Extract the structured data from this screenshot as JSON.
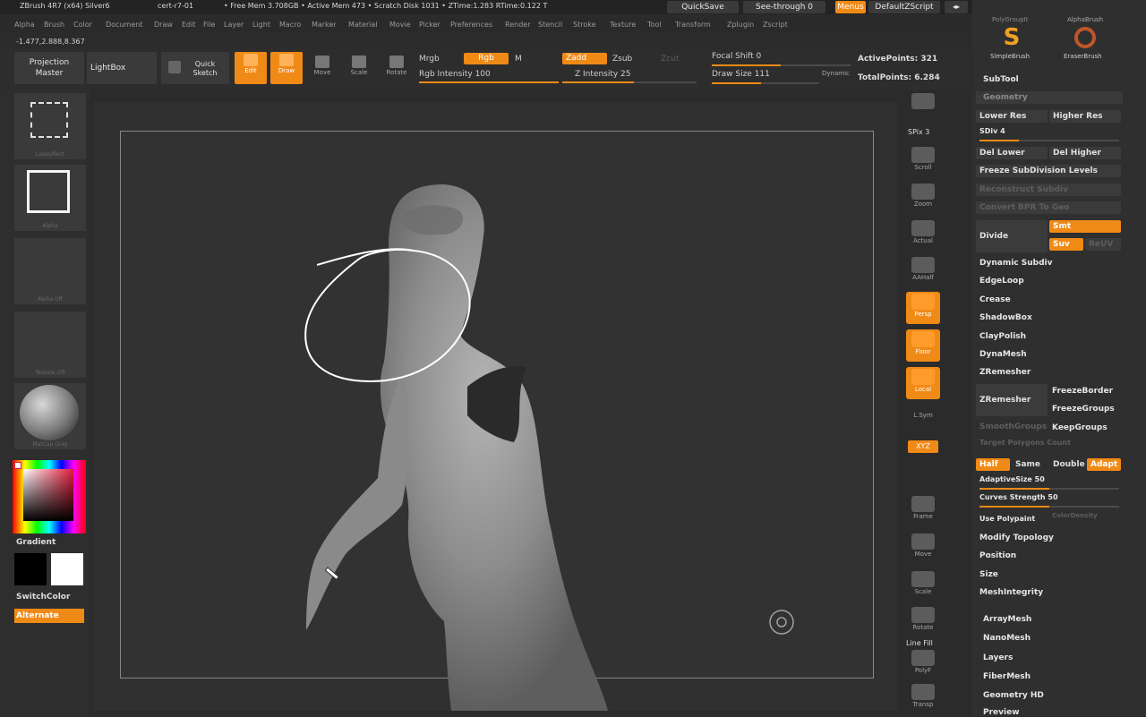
{
  "window": {
    "title": "ZBrush 4R7 (x64) Silver6",
    "doc": "cert-r7-01",
    "stats": "• Free Mem 3.708GB • Active Mem 473 • Scratch Disk 1031 • ZTime:1.283 RTime:0.122 T"
  },
  "titlebar_buttons": {
    "quicksave": "QuickSave",
    "see_through": "See-through 0",
    "menus": "Menus",
    "default_zscript": "DefaultZScript"
  },
  "menubar": [
    "Alpha",
    "Brush",
    "Color",
    "Document",
    "Draw",
    "Edit",
    "File",
    "Layer",
    "Light",
    "Macro",
    "Marker",
    "Material",
    "Movie",
    "Picker",
    "Preferences",
    "Render",
    "Stencil",
    "Stroke",
    "Texture",
    "Tool",
    "Transform",
    "Zplugin",
    "Zscript"
  ],
  "coords": "-1.477,2.888,8.367",
  "topbar": {
    "projection_master": "Projection Master",
    "lightbox": "LightBox",
    "quick_sketch": "Quick Sketch",
    "edit": "Edit",
    "draw": "Draw",
    "move": "Move",
    "scale": "Scale",
    "rotate": "Rotate",
    "mrgb": "Mrgb",
    "rgb": "Rgb",
    "m": "M",
    "zadd": "Zadd",
    "zsub": "Zsub",
    "zcut": "Zcut",
    "rgb_intensity": "Rgb Intensity 100",
    "z_intensity": "Z Intensity 25",
    "focal_shift": "Focal Shift 0",
    "draw_size": "Draw Size 111",
    "dynamic": "Dynamic",
    "active_points": "ActivePoints: 321",
    "total_points": "TotalPoints: 6.284"
  },
  "leftcol": {
    "thumb1_label": "Lasso/Rect",
    "thumb2_label": "Alpha",
    "thumb3_label": "Alpha Off",
    "thumb4_label": "Texture Off",
    "thumb5_label": "MatCap Gray",
    "gradient": "Gradient",
    "switchcolor": "SwitchColor",
    "alternate": "Alternate"
  },
  "shelf": {
    "spix": "SPix 3",
    "scroll": "Scroll",
    "zoom": "Zoom",
    "actual": "Actual",
    "aahalf": "AAHalf",
    "persp": "Persp",
    "floor": "Floor",
    "local": "Local",
    "lsym": "L.Sym",
    "xyz": "XYZ",
    "frame": "Frame",
    "move": "Move",
    "scale": "Scale",
    "rotate": "Rotate",
    "linefill": "Line Fill",
    "polyf": "PolyF",
    "transp": "Transp"
  },
  "panel": {
    "brush_simple": "SimpleBrush",
    "brush_eraser": "EraserBrush",
    "brush_alpha": "AlphaBrush",
    "subtool": "SubTool",
    "geometry": "Geometry",
    "lower_res": "Lower Res",
    "higher_res": "Higher Res",
    "sdiv": "SDiv 4",
    "del_lower": "Del Lower",
    "del_higher": "Del Higher",
    "freeze_subdiv": "Freeze SubDivision Levels",
    "reconstruct": "Reconstruct Subdiv",
    "convert_bpr": "Convert BPR To Geo",
    "divide": "Divide",
    "smt": "Smt",
    "suv": "Suv",
    "reuv": "ReUV",
    "dynamic_subdiv": "Dynamic Subdiv",
    "edgeloop": "EdgeLoop",
    "crease": "Crease",
    "shadowbox": "ShadowBox",
    "claypolish": "ClayPolish",
    "dynamesh": "DynaMesh",
    "zremesher_header": "ZRemesher",
    "zremesher_btn": "ZRemesher",
    "freezeborder": "FreezeBorder",
    "freezegroups": "FreezeGroups",
    "smoothgroups": "SmoothGroups",
    "keepgroups": "KeepGroups",
    "target_polycount": "Target Polygons Count",
    "half": "Half",
    "same": "Same",
    "double": "Double",
    "adapt": "Adapt",
    "adaptivesize": "AdaptiveSize 50",
    "curves_strength": "Curves Strength 50",
    "use_polypaint": "Use Polypaint",
    "colordensity": "ColorDensity",
    "modify_topology": "Modify Topology",
    "position": "Position",
    "size": "Size",
    "meshintegrity": "MeshIntegrity",
    "arraymesh": "ArrayMesh",
    "nanomesh": "NanoMesh",
    "layers": "Layers",
    "fibermesh": "FiberMesh",
    "geometry_hd": "Geometry HD",
    "preview": "Preview"
  },
  "colors": {
    "accent": "#f08a16",
    "panel": "#2f2f2f",
    "canvas": "#323232"
  }
}
